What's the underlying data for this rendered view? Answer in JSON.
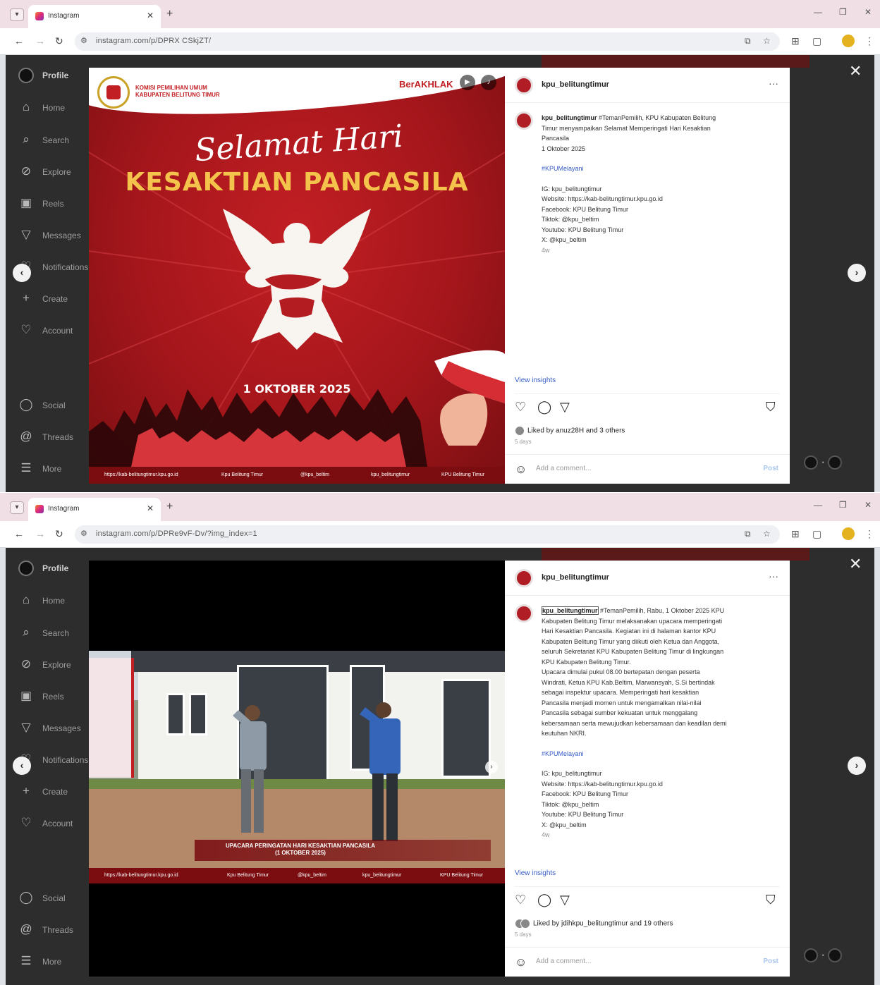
{
  "screens": [
    {
      "tab_title": "Instagram",
      "url": "instagram.com/p/DPRX CSkjZT/",
      "sidebar": [
        {
          "label": "Profile",
          "icon": "avatar"
        },
        {
          "label": "Home",
          "icon": "home-icon"
        },
        {
          "label": "Search",
          "icon": "search-icon"
        },
        {
          "label": "Explore",
          "icon": "compass-icon"
        },
        {
          "label": "Reels",
          "icon": "reels-icon"
        },
        {
          "label": "Messages",
          "icon": "send-icon"
        },
        {
          "label": "Notifications",
          "icon": "heart-icon"
        },
        {
          "label": "Create",
          "icon": "plus-icon"
        },
        {
          "label": "Account",
          "icon": "heart-outline-icon"
        },
        {
          "label": "Social",
          "icon": "meta-icon"
        },
        {
          "label": "Threads",
          "icon": "threads-icon"
        },
        {
          "label": "More",
          "icon": "menu-icon"
        }
      ],
      "poster": {
        "org": "KOMISI PEMILIHAN UMUM KABUPATEN BELITUNG TIMUR",
        "badge": "BerAKHLAK",
        "script": "Selamat Hari",
        "headline": "KESAKTIAN PANCASILA",
        "date": "1 OKTOBER 2025",
        "footer": [
          "https://kab-belitungtimur.kpu.go.id",
          "Kpu Belitung Timur",
          "@kpu_beltim",
          "kpu_belitungtimur",
          "KPU Belitung Timur"
        ]
      },
      "panel": {
        "username": "kpu_belitungtimur",
        "caption_user": "kpu_belitungtimur",
        "caption_lines": [
          "#TemanPemilih, KPU Kabupaten Belitung",
          "Timur menyampaikan Selamat Memperingati Hari Kesaktian",
          "Pancasila",
          "1 Oktober 2025"
        ],
        "hashtag": "#KPUMelayani",
        "links": [
          "IG: kpu_belitungtimur",
          "Website: https://kab-belitungtimur.kpu.go.id",
          "Facebook: KPU Belitung Timur",
          "Tiktok: @kpu_beltim",
          "Youtube: KPU Belitung Timur",
          "X: @kpu_beltim"
        ],
        "edited": "4w",
        "insights": "View insights",
        "likes": "Liked by anuz28H and 3 others",
        "time": "5 days",
        "comment_placeholder": "Add a comment...",
        "post_label": "Post"
      }
    },
    {
      "tab_title": "Instagram",
      "url": "instagram.com/p/DPRe9vF-Dv/?img_index=1",
      "sidebar": [
        {
          "label": "Profile",
          "icon": "avatar"
        },
        {
          "label": "Home",
          "icon": "home-icon"
        },
        {
          "label": "Search",
          "icon": "search-icon"
        },
        {
          "label": "Explore",
          "icon": "compass-icon"
        },
        {
          "label": "Reels",
          "icon": "reels-icon"
        },
        {
          "label": "Messages",
          "icon": "send-icon"
        },
        {
          "label": "Notifications",
          "icon": "heart-icon"
        },
        {
          "label": "Create",
          "icon": "plus-icon"
        },
        {
          "label": "Account",
          "icon": "heart-outline-icon"
        },
        {
          "label": "Social",
          "icon": "meta-icon"
        },
        {
          "label": "Threads",
          "icon": "threads-icon"
        },
        {
          "label": "More",
          "icon": "menu-icon"
        }
      ],
      "photo": {
        "caption_1": "UPACARA PERINGATAN HARI KESAKTIAN PANCASILA",
        "caption_2": "(1 OKTOBER 2025)",
        "footer": [
          "https://kab-belitungtimur.kpu.go.id",
          "Kpu Belitung Timur",
          "@kpu_beltim",
          "kpu_belitungtimur",
          "KPU Belitung Timur"
        ]
      },
      "panel": {
        "username": "kpu_belitungtimur",
        "caption_user": "kpu_belitungtimur",
        "caption_lines": [
          "#TemanPemilih, Rabu, 1 Oktober 2025 KPU",
          "Kabupaten Belitung Timur melaksanakan upacara memperingati",
          "Hari Kesaktian Pancasila. Kegiatan ini di halaman kantor KPU",
          "Kabupaten Belitung Timur yang diikuti oleh Ketua dan Anggota,",
          "seluruh Sekretariat KPU Kabupaten Belitung Timur di lingkungan",
          "KPU Kabupaten Belitung Timur.",
          "Upacara dimulai pukul 08.00 bertepatan dengan peserta",
          "Windrati, Ketua KPU Kab.Beltim, Marwansyah, S.Si bertindak",
          "sebagai inspektur upacara. Memperingati hari kesaktian",
          "Pancasila menjadi momen untuk mengamalkan nilai-nilai",
          "Pancasila sebagai sumber kekuatan untuk menggalang",
          "kebersamaan serta mewujudkan kebersamaan dan keadilan demi",
          "keutuhan NKRI."
        ],
        "hashtag": "#KPUMelayani",
        "links": [
          "IG: kpu_belitungtimur",
          "Website: https://kab-belitungtimur.kpu.go.id",
          "Facebook: KPU Belitung Timur",
          "Tiktok: @kpu_beltim",
          "Youtube: KPU Belitung Timur",
          "X: @kpu_beltim"
        ],
        "edited": "4w",
        "insights": "View insights",
        "likes": "Liked by jdihkpu_belitungtimur and 19 others",
        "time": "5 days",
        "comment_placeholder": "Add a comment...",
        "post_label": "Post"
      }
    }
  ]
}
